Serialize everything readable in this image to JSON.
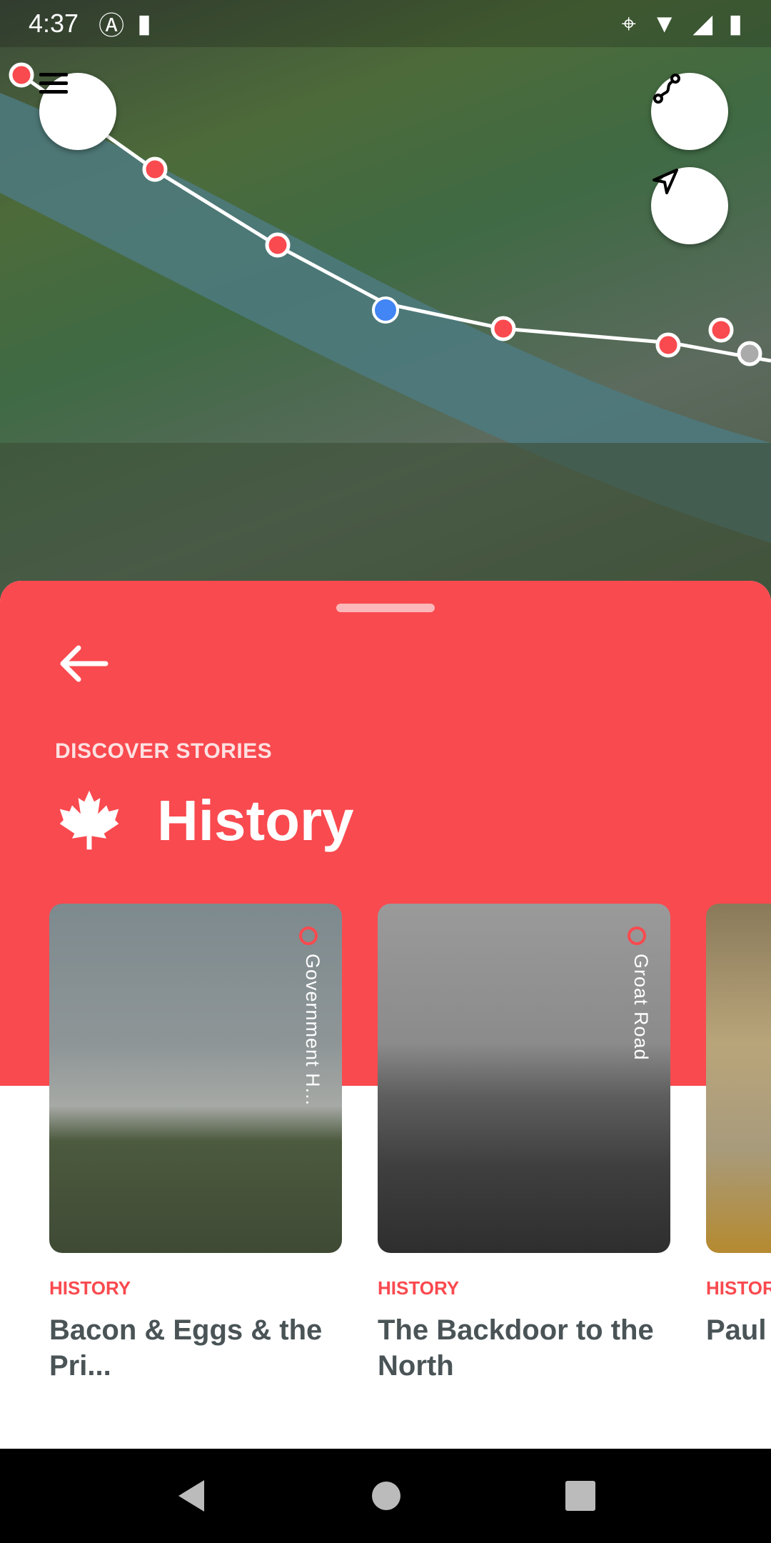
{
  "status_bar": {
    "time": "4:37"
  },
  "map": {
    "route_color": "#ffffff",
    "poi_color": "#f94a4f",
    "user_location_color": "#4285f4"
  },
  "sheet": {
    "kicker": "DISCOVER STORIES",
    "title": "History",
    "accent": "#f94a4f",
    "stories": [
      {
        "location": "Government H...",
        "category": "HISTORY",
        "title": "Bacon & Eggs & the Pri..."
      },
      {
        "location": "Groat Road",
        "category": "HISTORY",
        "title": "The Backdoor to the North"
      },
      {
        "location": "",
        "category": "HISTORY",
        "title": "Paul"
      }
    ]
  }
}
